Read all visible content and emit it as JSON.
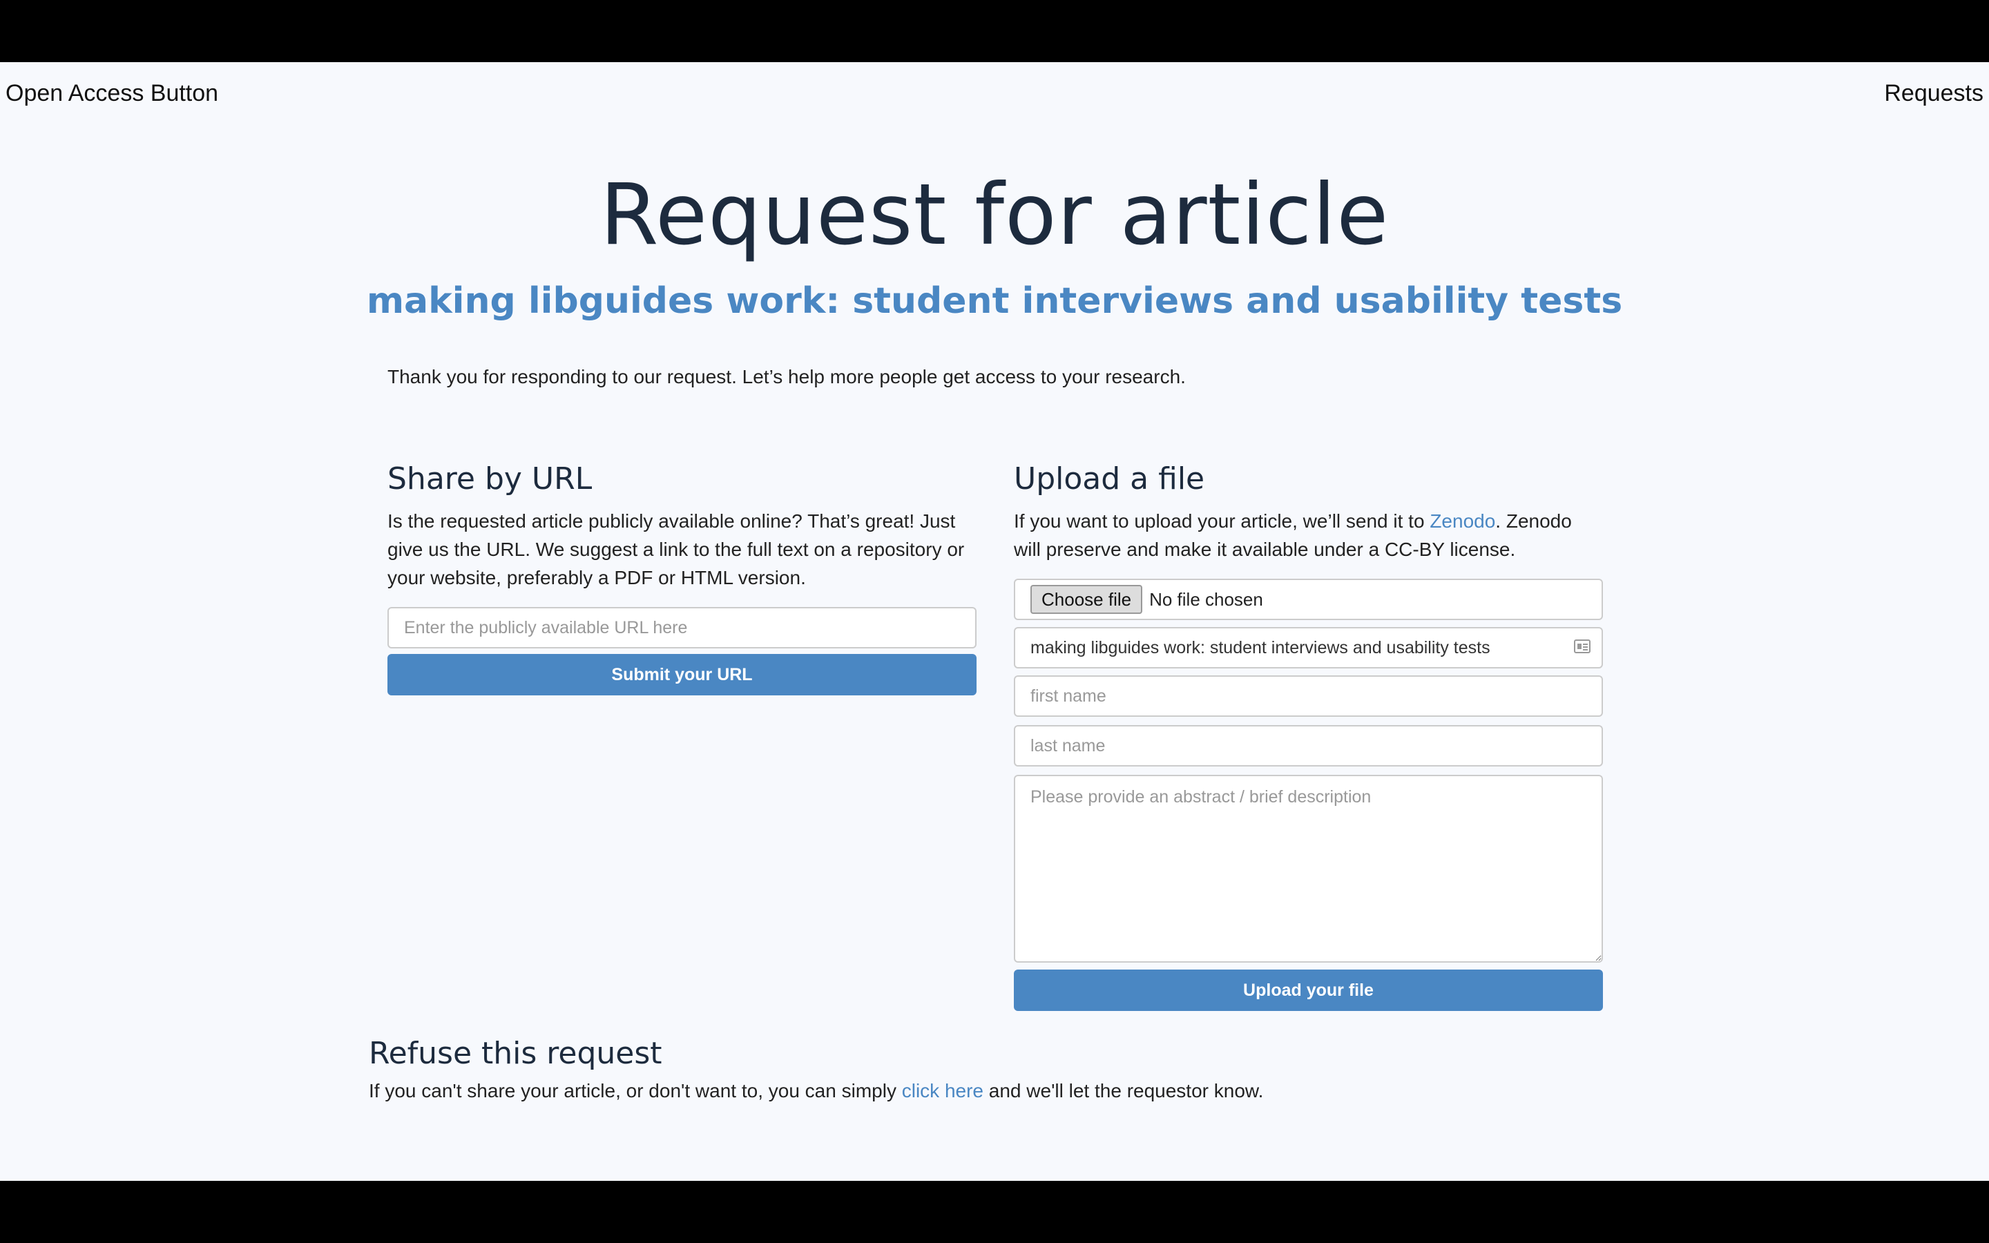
{
  "nav": {
    "brand": "Open Access Button",
    "link": "Requests"
  },
  "header": {
    "title": "Request for article",
    "article_title": "making libguides work: student interviews and usability tests",
    "intro": "Thank you for responding to our request. Let’s help more people get access to your research."
  },
  "share": {
    "heading": "Share by URL",
    "description": "Is the requested article publicly available online? That’s great! Just give us the URL. We suggest a link to the full text on a repository or your website, preferably a PDF or HTML version.",
    "url_placeholder": "Enter the publicly available URL here",
    "submit_label": "Submit your URL"
  },
  "upload": {
    "heading": "Upload a file",
    "desc_before": "If you want to upload your article, we’ll send it to ",
    "zenodo_link": "Zenodo",
    "desc_after": ". Zenodo will preserve and make it available under a CC-BY license.",
    "choose_file_label": "Choose file",
    "no_file_text": "No file chosen",
    "title_value": "making libguides work: student interviews and usability tests",
    "first_name_placeholder": "first name",
    "last_name_placeholder": "last name",
    "abstract_placeholder": "Please provide an abstract / brief description",
    "submit_label": "Upload your file",
    "autofill_icon": "contact-card-icon"
  },
  "refuse": {
    "heading": "Refuse this request",
    "text_before": "If you can't share your article, or don't want to, you can simply ",
    "link_text": "click here",
    "text_after": " and we'll let the requestor know."
  },
  "colors": {
    "accent": "#4a87c3",
    "heading": "#1d2b3e",
    "background": "#f7f9fd"
  }
}
